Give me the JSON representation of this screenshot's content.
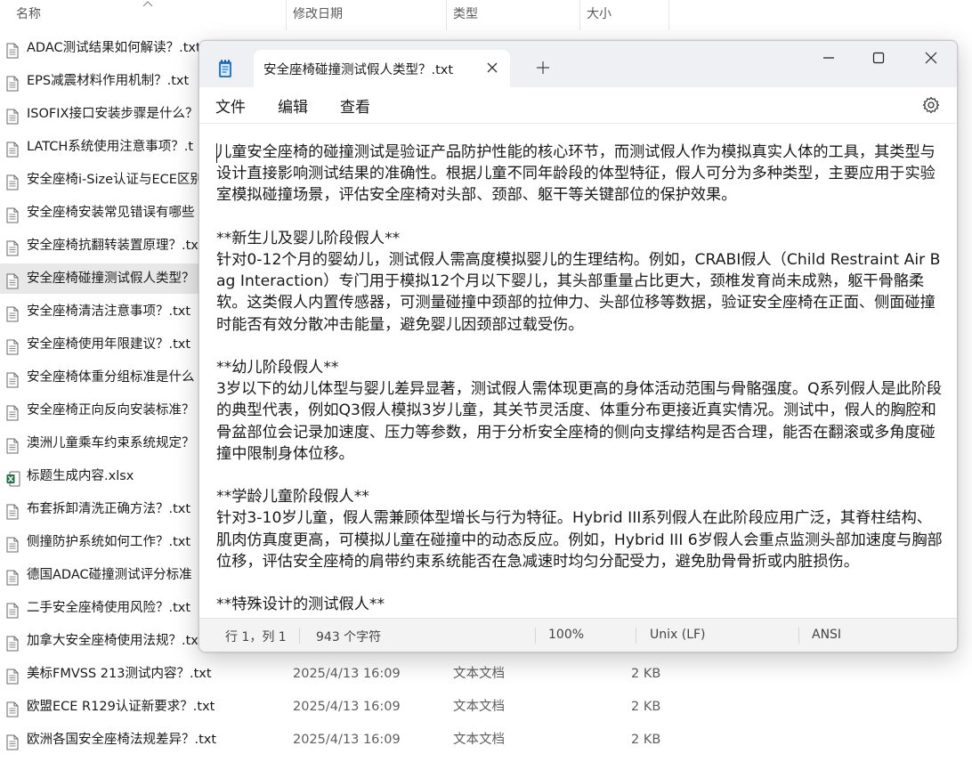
{
  "explorer": {
    "columns": {
      "name": "名称",
      "date": "修改日期",
      "type": "类型",
      "size": "大小"
    },
    "files": [
      {
        "name": "ADAC测试结果如何解读？.txt",
        "date": "",
        "type": "",
        "size": "",
        "kind": "txt"
      },
      {
        "name": "EPS减震材料作用机制？.txt",
        "date": "",
        "type": "",
        "size": "",
        "kind": "txt"
      },
      {
        "name": "ISOFIX接口安装步骤是什么？",
        "date": "",
        "type": "",
        "size": "",
        "kind": "txt"
      },
      {
        "name": "LATCH系统使用注意事项？.t",
        "date": "",
        "type": "",
        "size": "",
        "kind": "txt"
      },
      {
        "name": "安全座椅i-Size认证与ECE区别",
        "date": "",
        "type": "",
        "size": "",
        "kind": "txt"
      },
      {
        "name": "安全座椅安装常见错误有哪些",
        "date": "",
        "type": "",
        "size": "",
        "kind": "txt"
      },
      {
        "name": "安全座椅抗翻转装置原理？.tx",
        "date": "",
        "type": "",
        "size": "",
        "kind": "txt"
      },
      {
        "name": "安全座椅碰撞测试假人类型？",
        "date": "",
        "type": "",
        "size": "",
        "kind": "txt",
        "selected": true
      },
      {
        "name": "安全座椅清洁注意事项？.txt",
        "date": "",
        "type": "",
        "size": "",
        "kind": "txt"
      },
      {
        "name": "安全座椅使用年限建议？.txt",
        "date": "",
        "type": "",
        "size": "",
        "kind": "txt"
      },
      {
        "name": "安全座椅体重分组标准是什么",
        "date": "",
        "type": "",
        "size": "",
        "kind": "txt"
      },
      {
        "name": "安全座椅正向反向安装标准？",
        "date": "",
        "type": "",
        "size": "",
        "kind": "txt"
      },
      {
        "name": "澳洲儿童乘车约束系统规定？",
        "date": "",
        "type": "",
        "size": "",
        "kind": "txt"
      },
      {
        "name": "标题生成内容.xlsx",
        "date": "",
        "type": "",
        "size": "",
        "kind": "xlsx"
      },
      {
        "name": "布套拆卸清洗正确方法？.txt",
        "date": "",
        "type": "",
        "size": "",
        "kind": "txt"
      },
      {
        "name": "侧撞防护系统如何工作？.txt",
        "date": "",
        "type": "",
        "size": "",
        "kind": "txt"
      },
      {
        "name": "德国ADAC碰撞测试评分标准",
        "date": "",
        "type": "",
        "size": "",
        "kind": "txt"
      },
      {
        "name": "二手安全座椅使用风险？.txt",
        "date": "",
        "type": "",
        "size": "",
        "kind": "txt"
      },
      {
        "name": "加拿大安全座椅使用法规？.tx",
        "date": "",
        "type": "",
        "size": "",
        "kind": "txt"
      },
      {
        "name": "美标FMVSS 213测试内容？.txt",
        "date": "2025/4/13 16:09",
        "type": "文本文档",
        "size": "2 KB",
        "kind": "txt"
      },
      {
        "name": "欧盟ECE R129认证新要求？.txt",
        "date": "2025/4/13 16:09",
        "type": "文本文档",
        "size": "2 KB",
        "kind": "txt"
      },
      {
        "name": "欧洲各国安全座椅法规差异？.txt",
        "date": "2025/4/13 16:09",
        "type": "文本文档",
        "size": "2 KB",
        "kind": "txt"
      }
    ]
  },
  "notepad": {
    "tab_title": "安全座椅碰撞测试假人类型？.txt",
    "menu": {
      "file": "文件",
      "edit": "编辑",
      "view": "查看"
    },
    "content": "儿童安全座椅的碰撞测试是验证产品防护性能的核心环节，而测试假人作为模拟真实人体的工具，其类型与设计直接影响测试结果的准确性。根据儿童不同年龄段的体型特征，假人可分为多种类型，主要应用于实验室模拟碰撞场景，评估安全座椅对头部、颈部、躯干等关键部位的保护效果。\n\n**新生儿及婴儿阶段假人**\n针对0-12个月的婴幼儿，测试假人需高度模拟婴儿的生理结构。例如，CRABI假人（Child Restraint Air Bag Interaction）专门用于模拟12个月以下婴儿，其头部重量占比更大，颈椎发育尚未成熟，躯干骨骼柔软。这类假人内置传感器，可测量碰撞中颈部的拉伸力、头部位移等数据，验证安全座椅在正面、侧面碰撞时能否有效分散冲击能量，避免婴儿因颈部过载受伤。\n\n**幼儿阶段假人**\n3岁以下的幼儿体型与婴儿差异显著，测试假人需体现更高的身体活动范围与骨骼强度。Q系列假人是此阶段的典型代表，例如Q3假人模拟3岁儿童，其关节灵活度、体重分布更接近真实情况。测试中，假人的胸腔和骨盆部位会记录加速度、压力等参数，用于分析安全座椅的侧向支撑结构是否合理，能否在翻滚或多角度碰撞中限制身体位移。\n\n**学龄儿童阶段假人**\n针对3-10岁儿童，假人需兼顾体型增长与行为特征。Hybrid III系列假人在此阶段应用广泛，其脊柱结构、肌肉仿真度更高，可模拟儿童在碰撞中的动态反应。例如，Hybrid III 6岁假人会重点监测头部加速度与胸部位移，评估安全座椅的肩带约束系统能否在急减速时均匀分配受力，避免肋骨骨折或内脏损伤。\n\n**特殊设计的测试假人**",
    "status": {
      "position": "行 1，列 1",
      "chars": "943 个字符",
      "zoom": "100%",
      "line_ending": "Unix (LF)",
      "encoding": "ANSI"
    }
  },
  "colors": {
    "titlebar": "#eef0f3",
    "selection": "#e8e8e8",
    "statusbar": "#f3f3f3",
    "excel_green": "#1d7044"
  }
}
